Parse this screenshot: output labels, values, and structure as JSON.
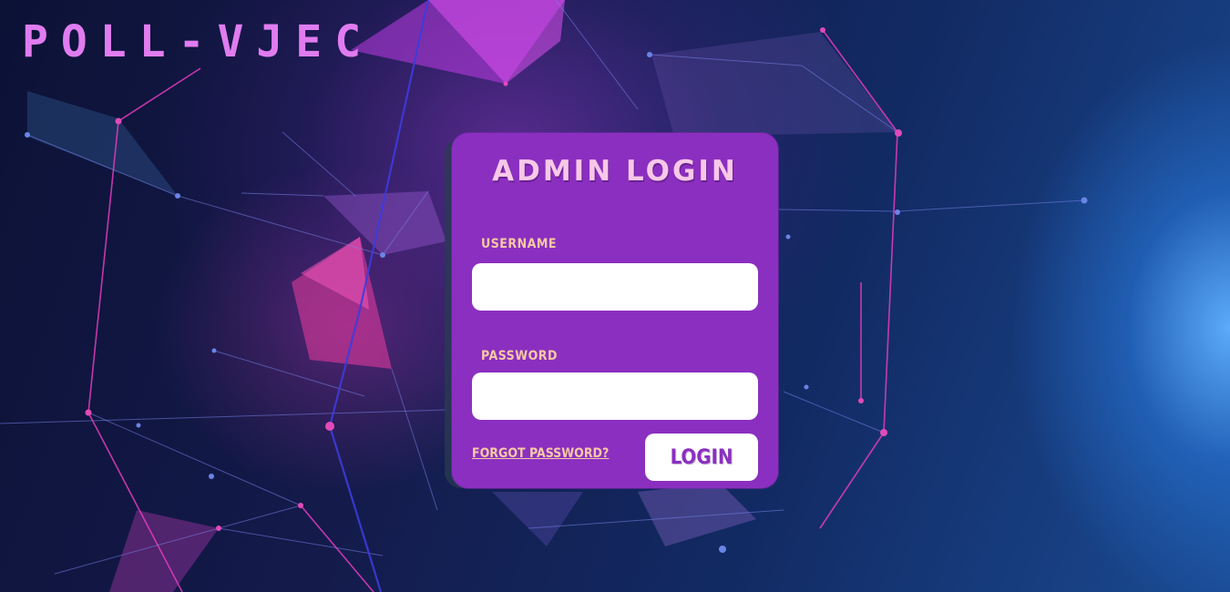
{
  "header": {
    "brand": "POLL-VJEC"
  },
  "login_card": {
    "title": "ADMIN LOGIN",
    "username_label": "USERNAME",
    "username_value": "",
    "password_label": "PASSWORD",
    "password_value": "",
    "forgot_label": "FORGOT PASSWORD?",
    "login_label": "LOGIN"
  },
  "colors": {
    "card": "#8b2fc0",
    "brand_text": "#e07cf0",
    "title_text": "#f8c8e8",
    "label_text": "#f6c9a4",
    "button_text": "#8b2fc0"
  }
}
